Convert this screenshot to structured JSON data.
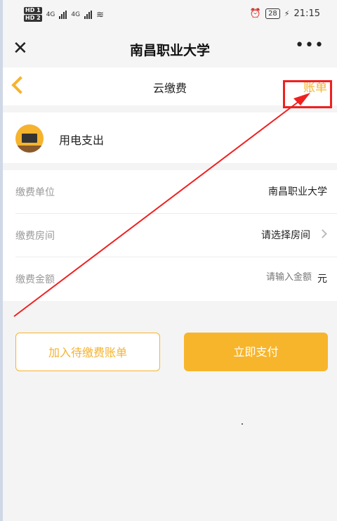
{
  "status_bar": {
    "hd1": "HD 1",
    "hd2": "HD 2",
    "net1": "4G",
    "net2": "4G",
    "battery": "28",
    "time": "21:15"
  },
  "title_bar": {
    "title": "南昌职业大学",
    "close_icon": "close-icon",
    "more_icon": "more-icon"
  },
  "nav": {
    "title": "云缴费",
    "bill_link": "账单"
  },
  "service": {
    "label": "用电支出"
  },
  "form": {
    "unit": {
      "label": "缴费单位",
      "value": "南昌职业大学"
    },
    "room": {
      "label": "缴费房间",
      "value": "请选择房间"
    },
    "amount": {
      "label": "缴费金额",
      "placeholder": "请输入金额",
      "suffix": "元"
    }
  },
  "actions": {
    "add_to_pending": "加入待缴费账单",
    "pay_now": "立即支付"
  },
  "colors": {
    "accent": "#f5b32e",
    "annotation": "#f02020"
  }
}
